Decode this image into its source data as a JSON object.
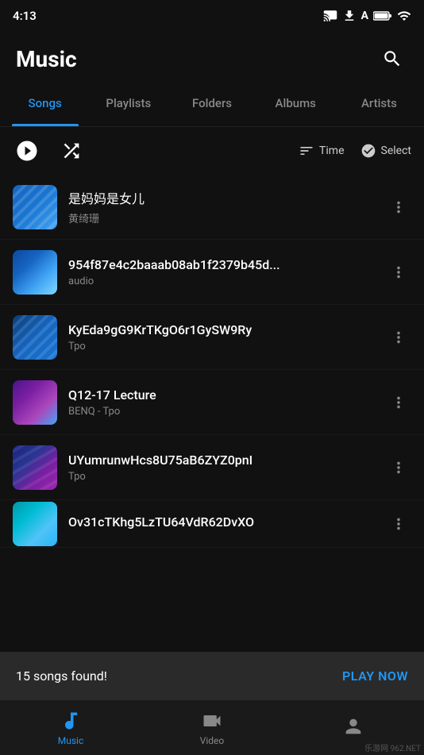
{
  "statusBar": {
    "time": "4:13",
    "icons": [
      "cast",
      "download",
      "text",
      "battery-full"
    ]
  },
  "header": {
    "title": "Music",
    "searchLabel": "Search"
  },
  "tabs": [
    {
      "id": "songs",
      "label": "Songs",
      "active": true
    },
    {
      "id": "playlists",
      "label": "Playlists",
      "active": false
    },
    {
      "id": "folders",
      "label": "Folders",
      "active": false
    },
    {
      "id": "albums",
      "label": "Albums",
      "active": false
    },
    {
      "id": "artists",
      "label": "Artists",
      "active": false
    }
  ],
  "toolbar": {
    "playAllLabel": "Play All",
    "shuffleLabel": "Shuffle",
    "sortLabel": "Time",
    "selectLabel": "Select"
  },
  "songs": [
    {
      "id": 1,
      "title": "是妈妈是女儿",
      "artist": "黄绮珊",
      "artClass": "art-1"
    },
    {
      "id": 2,
      "title": "954f87e4c2baaab08ab1f2379b45d...",
      "artist": "audio",
      "artClass": "art-2"
    },
    {
      "id": 3,
      "title": "KyEda9gG9KrTKgO6r1GySW9Ry",
      "artist": "Tpo",
      "artClass": "art-3"
    },
    {
      "id": 4,
      "title": "Q12-17 Lecture",
      "artist": "BENQ - Tpo",
      "artClass": "art-4"
    },
    {
      "id": 5,
      "title": "UYumrunwHcs8U75aB6ZYZ0pnI",
      "artist": "Tpo",
      "artClass": "art-5"
    },
    {
      "id": 6,
      "title": "Ov31cTKhg5LzTU64VdR62DvXO",
      "artist": "",
      "artClass": "art-6"
    }
  ],
  "notification": {
    "text": "15 songs found!",
    "playNowLabel": "PLAY NOW"
  },
  "bottomNav": [
    {
      "id": "music",
      "label": "Music",
      "active": true
    },
    {
      "id": "video",
      "label": "Video",
      "active": false
    },
    {
      "id": "more",
      "label": "",
      "active": false
    }
  ]
}
